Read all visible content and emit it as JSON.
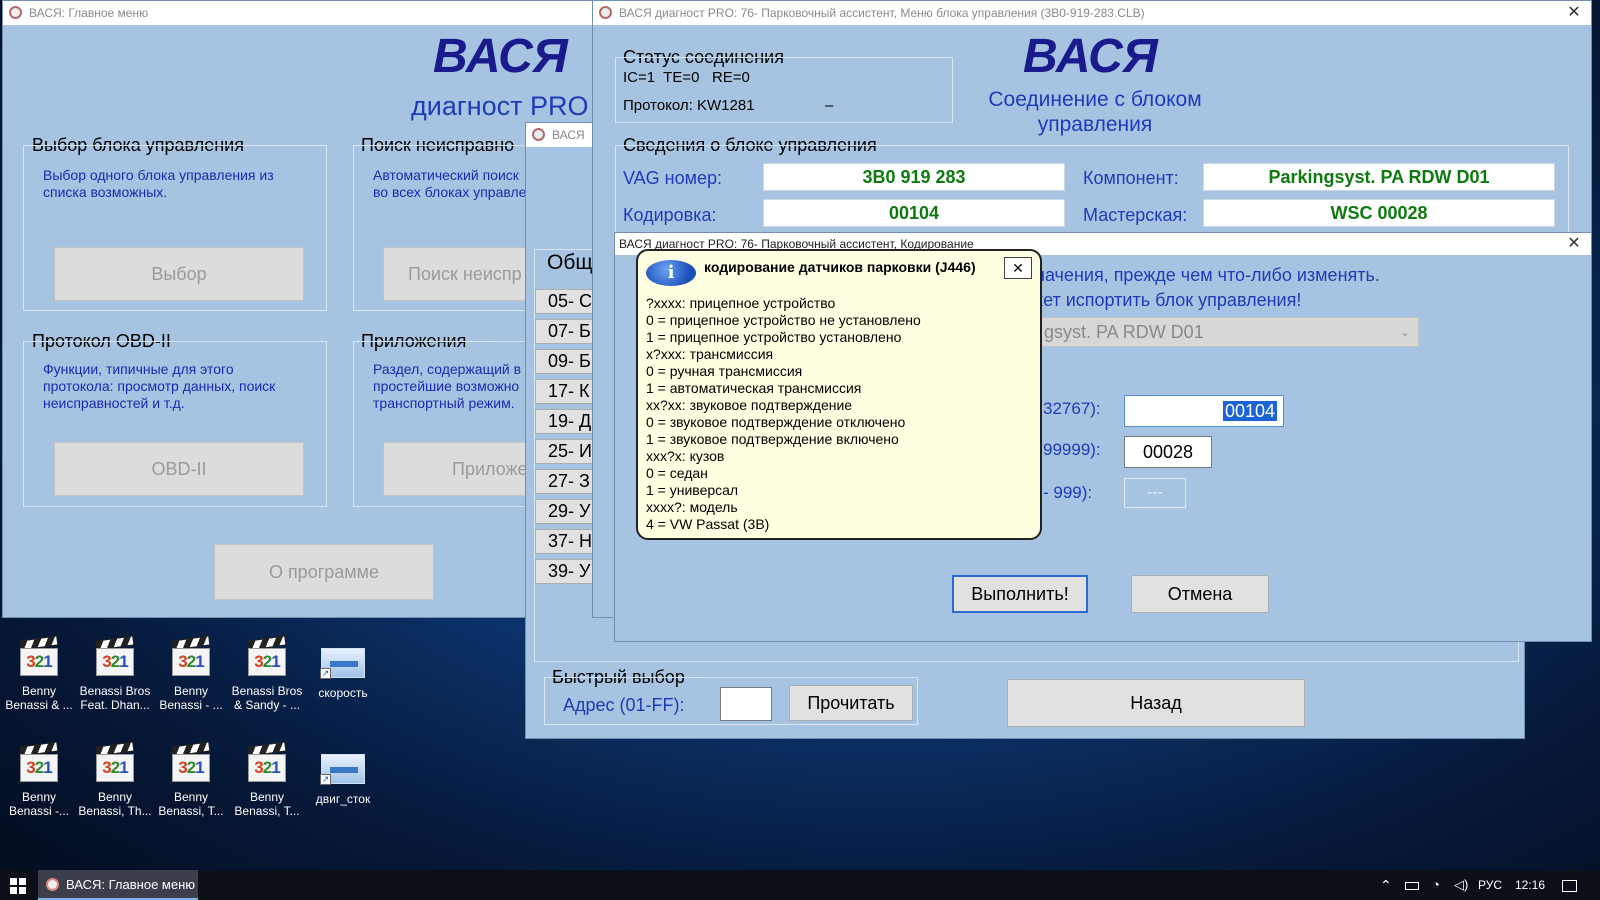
{
  "main_menu": {
    "title": "ВАСЯ:  Главное меню",
    "brand": "ВАСЯ",
    "brand_sub": "диагност PRO",
    "select_group": {
      "title": "Выбор блока управления",
      "text": "Выбор одного блока управления из списка возможных.",
      "button": "Выбор"
    },
    "search_group": {
      "title": "Поиск неисправно",
      "text": "Автоматический поиск во всех блоках управле",
      "button": "Поиск неиспр"
    },
    "obd_group": {
      "title": "Протокол OBD-II",
      "text": "Функции, типичные для этого протокола: просмотр данных, поиск неисправностей и т.д.",
      "button": "OBD-II"
    },
    "apps_group": {
      "title": "Приложения",
      "text": "Раздел, содержащий в простейшие возможно транспортный режим.",
      "button": "Приложе"
    },
    "about_button": "О программе"
  },
  "select_window": {
    "title": "ВАСЯ",
    "list_header": "Общ",
    "items": [
      "05- С",
      "07- Б",
      "09- Б",
      "17- К",
      "19- Д",
      "25- И",
      "27- З",
      "29- У",
      "37- Н",
      "39- У"
    ],
    "quick_title": "Быстрый выбор",
    "address_label": "Адрес (01-FF):",
    "address_value": "",
    "read_button": "Прочитать",
    "back_button": "Назад"
  },
  "control_unit_window": {
    "title": "ВАСЯ диагност PRO: 76- Парковочный ассистент,  Меню блока управления (3B0-919-283.CLB)",
    "close": "✕",
    "status_title": "Статус соединения",
    "status_line": "IC=1  TE=0   RE=0",
    "protocol_line": "Протокол: KW1281",
    "protocol_dash": "–",
    "brand": "ВАСЯ",
    "connection_text": "Соединение с блоком управления",
    "info_title": "Сведения о блоке управления",
    "vag_label": "VAG номер:",
    "vag_value": "3B0 919 283",
    "component_label": "Компонент:",
    "component_value": "Parkingsyst. PA RDW D01",
    "coding_label": "Кодировка:",
    "coding_value": "00104",
    "workshop_label": "Мастерская:",
    "workshop_value": "WSC 00028"
  },
  "coding_window": {
    "title": "ВАСЯ диагност PRO: 76- Парковочный ассистент,  Кодирование",
    "close": "✕",
    "warning_line1": "начения, прежде чем что-либо изменять.",
    "warning_line2": "кет испортить блок управления!",
    "combo_value": "gsyst. PA RDW D01",
    "range1_label": "32767):",
    "range1_value": "00104",
    "range2_label": "99999):",
    "range2_value": "00028",
    "range3_label": "- 999):",
    "range3_value": "---",
    "execute_button": "Выполнить!",
    "cancel_button": "Отмена"
  },
  "tooltip": {
    "title": "кодирование датчиков парковки (J446)",
    "close": "✕",
    "lines": [
      "?xxxx: прицепное устройство",
      "0 = прицепное устройство не установлено",
      "1 = прицепное устройство установлено",
      "x?xxx: трансмиссия",
      "0 = ручная трансмиссия",
      "1 = автоматическая трансмиссия",
      "xx?xx: звуковое подтверждение",
      "0 = звуковое подтверждение отключено",
      "1 = звуковое подтверждение включено",
      "xxx?x: кузов",
      "0 = седан",
      "1 = универсал",
      "xxxx?: модель",
      "4 = VW Passat (3B)"
    ]
  },
  "desktop": {
    "icons_row1": [
      {
        "label": "Benny Benassi & ...",
        "icon": "media-player-classic-icon"
      },
      {
        "label": "Benassi Bros Feat. Dhan...",
        "icon": "media-player-classic-icon"
      },
      {
        "label": "Benny Benassi - ...",
        "icon": "media-player-classic-icon"
      },
      {
        "label": "Benassi Bros & Sandy - ...",
        "icon": "media-player-classic-icon"
      },
      {
        "label": "скорость",
        "icon": "shortcut-icon"
      }
    ],
    "icons_row2": [
      {
        "label": "Benny Benassi -...",
        "icon": "media-player-classic-icon"
      },
      {
        "label": "Benny Benassi, Th...",
        "icon": "media-player-classic-icon"
      },
      {
        "label": "Benny Benassi, T...",
        "icon": "media-player-classic-icon"
      },
      {
        "label": "Benny Benassi, T...",
        "icon": "media-player-classic-icon"
      },
      {
        "label": "двиг_сток",
        "icon": "shortcut-icon"
      }
    ],
    "icon_digits": [
      "3",
      "2",
      "1"
    ]
  },
  "taskbar": {
    "app_label": "ВАСЯ:  Главное меню",
    "language": "РУС",
    "time": "12:16"
  }
}
